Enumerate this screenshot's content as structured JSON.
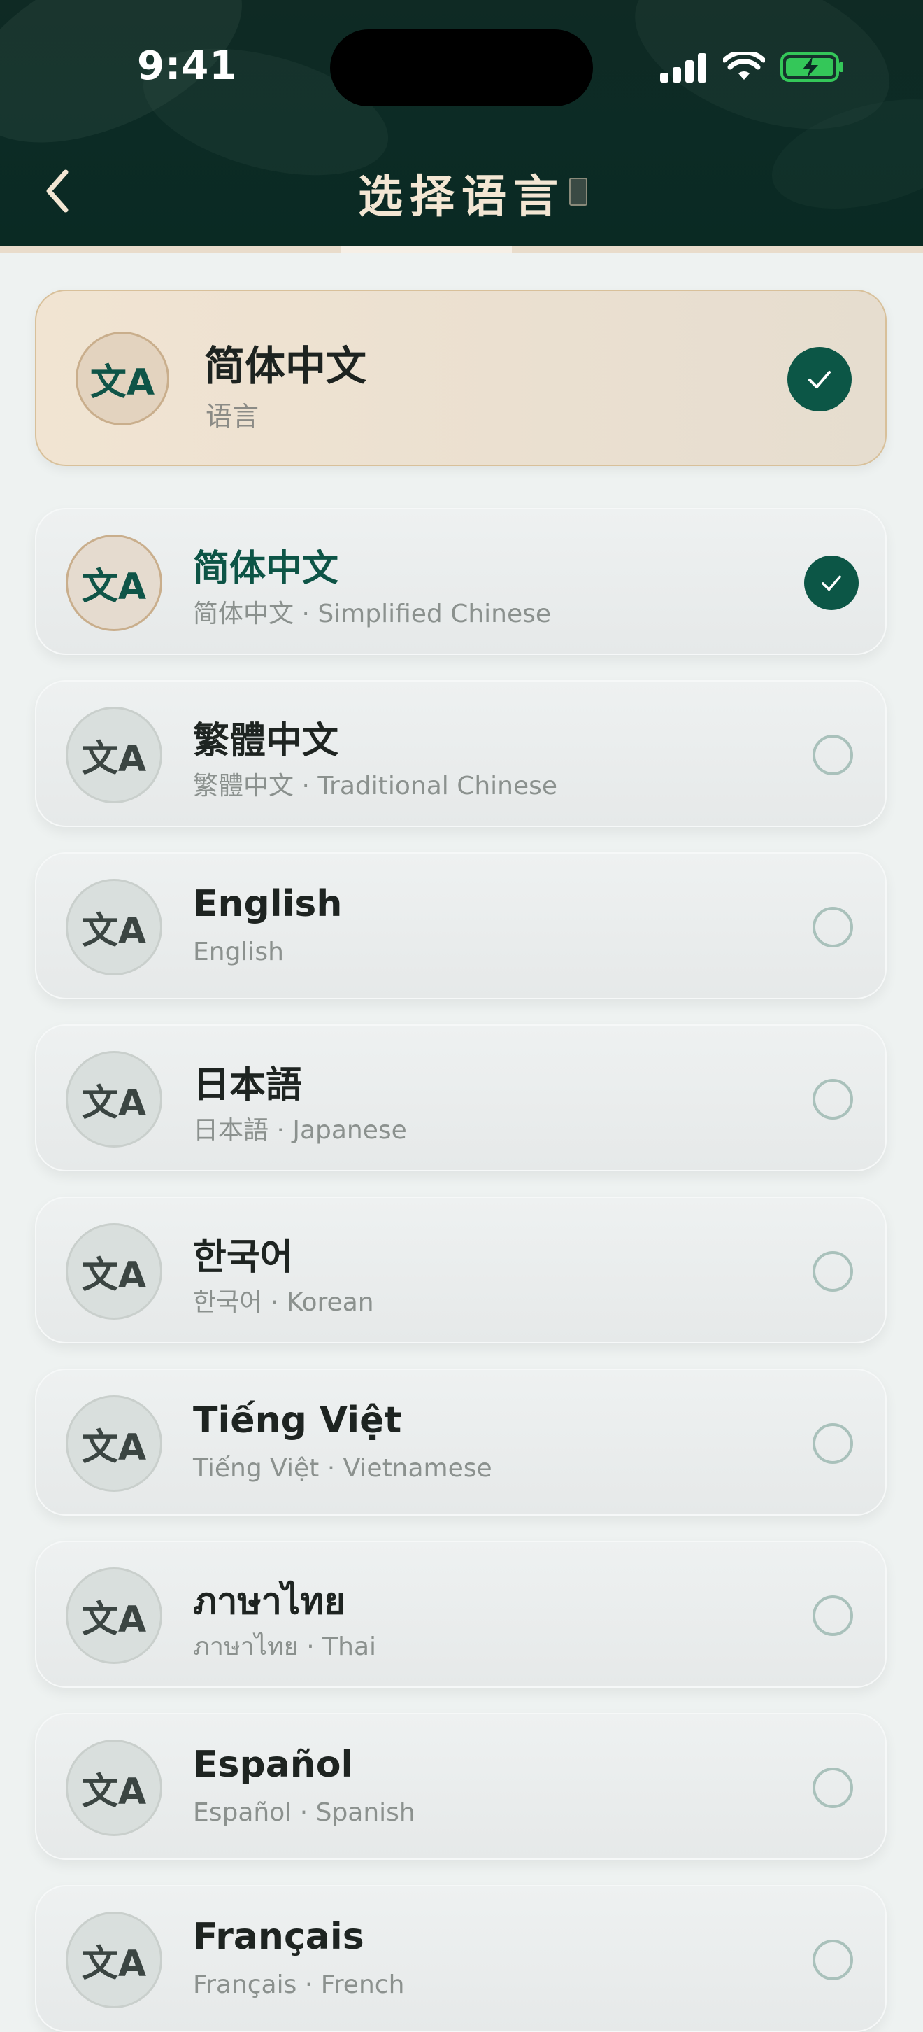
{
  "status_bar": {
    "time": "9:41"
  },
  "nav": {
    "title": "选择语言"
  },
  "current": {
    "icon_text": "文A",
    "title": "简体中文",
    "subtitle": "语言"
  },
  "icon_text": "文A",
  "languages": [
    {
      "name": "简体中文",
      "sub": "简体中文 · Simplified Chinese",
      "selected": true
    },
    {
      "name": "繁體中文",
      "sub": "繁體中文 · Traditional Chinese",
      "selected": false
    },
    {
      "name": "English",
      "sub": "English",
      "selected": false
    },
    {
      "name": "日本語",
      "sub": "日本語 · Japanese",
      "selected": false
    },
    {
      "name": "한국어",
      "sub": "한국어 · Korean",
      "selected": false
    },
    {
      "name": "Tiếng Việt",
      "sub": "Tiếng Việt · Vietnamese",
      "selected": false
    },
    {
      "name": "ภาษาไทย",
      "sub": "ภาษาไทย · Thai",
      "selected": false
    },
    {
      "name": "Español",
      "sub": "Español · Spanish",
      "selected": false
    },
    {
      "name": "Français",
      "sub": "Français · French",
      "selected": false
    }
  ],
  "colors": {
    "header_bg": "#0c2b25",
    "accent_green": "#0c5646",
    "title_gold": "#f3e6d3",
    "battery_green": "#34c759"
  },
  "icons": [
    "back-chevron-icon",
    "signal-icon",
    "wifi-icon",
    "battery-charging-icon",
    "checkmark-icon",
    "radio-unselected-icon",
    "language-icon"
  ]
}
